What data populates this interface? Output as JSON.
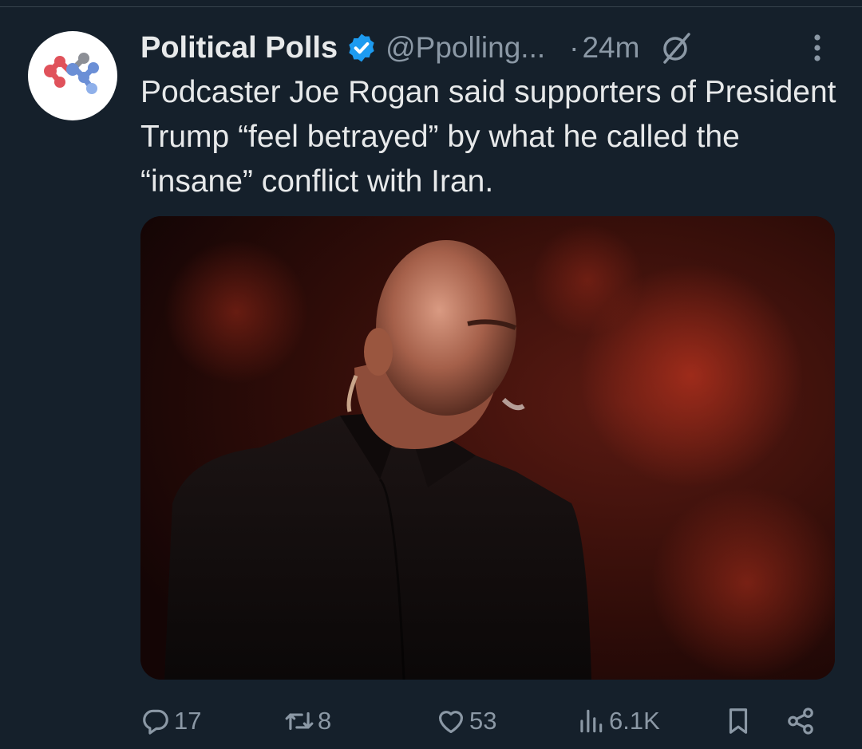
{
  "post": {
    "author_name": "Political Polls",
    "author_handle": "@Ppolling...",
    "separator": "·",
    "timestamp": "24m",
    "text": "Podcaster Joe Rogan said supporters of President Trump “feel betrayed” by what he called the “insane” conflict with Iran."
  },
  "actions": {
    "replies": "17",
    "reposts": "8",
    "likes": "53",
    "views": "6.1K"
  },
  "icons": {
    "verified": "verified-badge-icon",
    "grok": "grok-icon",
    "more": "more-vertical-icon",
    "reply": "reply-icon",
    "repost": "repost-icon",
    "like": "heart-icon",
    "views": "views-chart-icon",
    "bookmark": "bookmark-icon",
    "share": "share-icon"
  },
  "colors": {
    "background": "#15202b",
    "primary_text": "#e7e9ea",
    "secondary_text": "#8b98a5",
    "verified_blue": "#1d9bf0"
  }
}
